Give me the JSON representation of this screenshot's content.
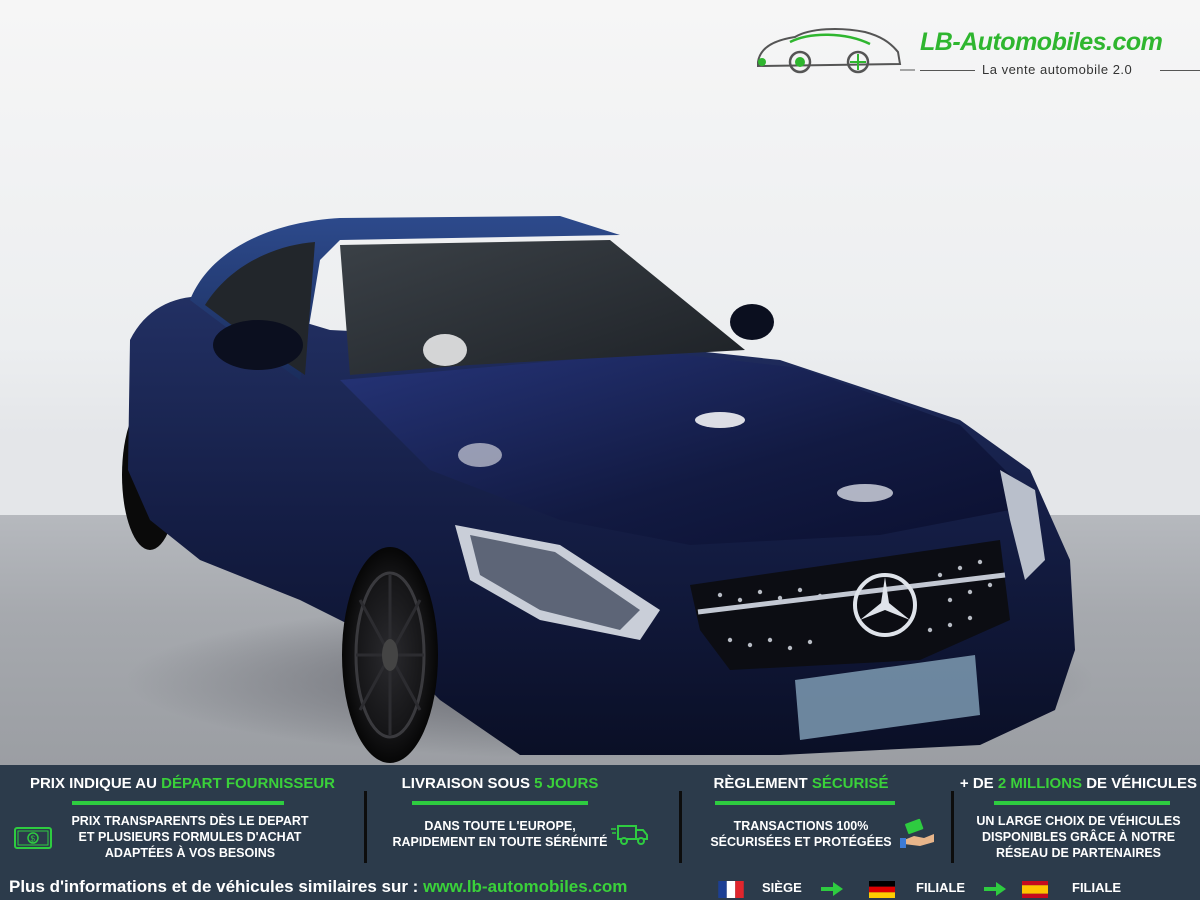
{
  "logo": {
    "title": "LB-Automobiles.com",
    "subtitle": "La vente automobile 2.0",
    "icon": "car-logo-icon"
  },
  "photo": {
    "subject": "car-photo",
    "colors": {
      "body": "#16224a",
      "top": "#1f3a73",
      "wheel": "#111111"
    }
  },
  "banner": {
    "background": "#2c3b4b",
    "accent": "#2ecc40",
    "features": [
      {
        "title_pre": "PRIX INDIQUE AU ",
        "title_hl": "DÉPART FOURNISSEUR",
        "title_post": "",
        "lines": [
          "PRIX TRANSPARENTS DÈS LE DEPART",
          "ET PLUSIEURS FORMULES D'ACHAT",
          "ADAPTÉES À VOS BESOINS"
        ],
        "icon": "money-icon"
      },
      {
        "title_pre": "LIVRAISON SOUS ",
        "title_hl": "5 JOURS",
        "title_post": "",
        "lines": [
          "DANS TOUTE L'EUROPE,",
          "RAPIDEMENT EN TOUTE SÉRÉNITÉ"
        ],
        "icon": "delivery-truck-icon"
      },
      {
        "title_pre": "RÈGLEMENT ",
        "title_hl": "SÉCURISÉ",
        "title_post": "",
        "lines": [
          "TRANSACTIONS 100%",
          "SÉCURISÉES ET PROTÉGÉES"
        ],
        "icon": "payment-hand-icon"
      },
      {
        "title_pre": "+ DE ",
        "title_hl": "2 MILLIONS",
        "title_post": " DE VÉHICULES",
        "lines": [
          "UN LARGE CHOIX DE VÉHICULES",
          "DISPONIBLES GRÂCE À NOTRE",
          "RÉSEAU DE PARTENAIRES"
        ],
        "icon": ""
      }
    ],
    "info_text": "Plus d'informations et de véhicules similaires sur : ",
    "info_url": "www.lb-automobiles.com",
    "locations": [
      {
        "flag": "france-flag-icon",
        "label": "SIÈGE"
      },
      {
        "flag": "germany-flag-icon",
        "label": "FILIALE"
      },
      {
        "flag": "spain-flag-icon",
        "label": "FILIALE"
      }
    ]
  }
}
